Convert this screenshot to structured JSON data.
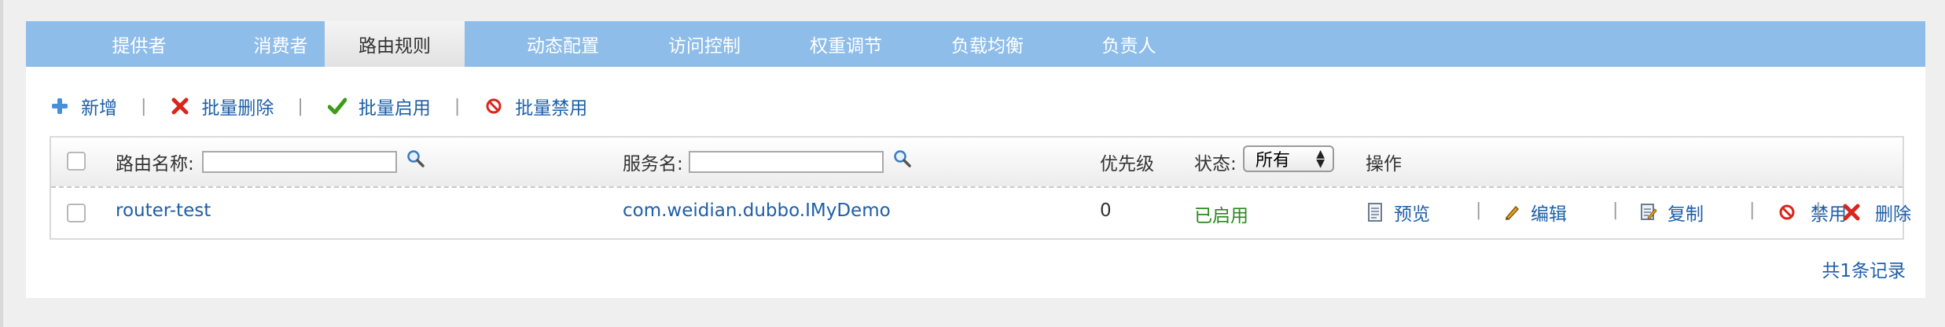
{
  "tabs": [
    {
      "label": "提供者"
    },
    {
      "label": "消费者"
    },
    {
      "label": "路由规则"
    },
    {
      "label": "动态配置"
    },
    {
      "label": "访问控制"
    },
    {
      "label": "权重调节"
    },
    {
      "label": "负载均衡"
    },
    {
      "label": "负责人"
    }
  ],
  "active_tab": "路由规则",
  "toolbar": {
    "add": "新增",
    "batch_delete": "批量删除",
    "batch_enable": "批量启用",
    "batch_disable": "批量禁用",
    "separator": "|"
  },
  "filters": {
    "route_name_label": "路由名称:",
    "route_name_value": "",
    "service_name_label": "服务名:",
    "service_name_value": "",
    "priority_label": "优先级",
    "status_label": "状态:",
    "status_selected": "所有",
    "operations_label": "操作"
  },
  "rows": [
    {
      "name": "router-test",
      "service": "com.weidian.dubbo.IMyDemo",
      "priority": "0",
      "status": "已启用",
      "actions": {
        "preview": "预览",
        "edit": "编辑",
        "copy": "复制",
        "disable": "禁用",
        "delete": "删除"
      }
    }
  ],
  "footer": {
    "total_records": "共1条记录"
  },
  "colors": {
    "tabbar": "#8fbde9",
    "link": "#1d5fa8",
    "enabled": "#2b8a1e",
    "delete_red": "#d8261b"
  }
}
